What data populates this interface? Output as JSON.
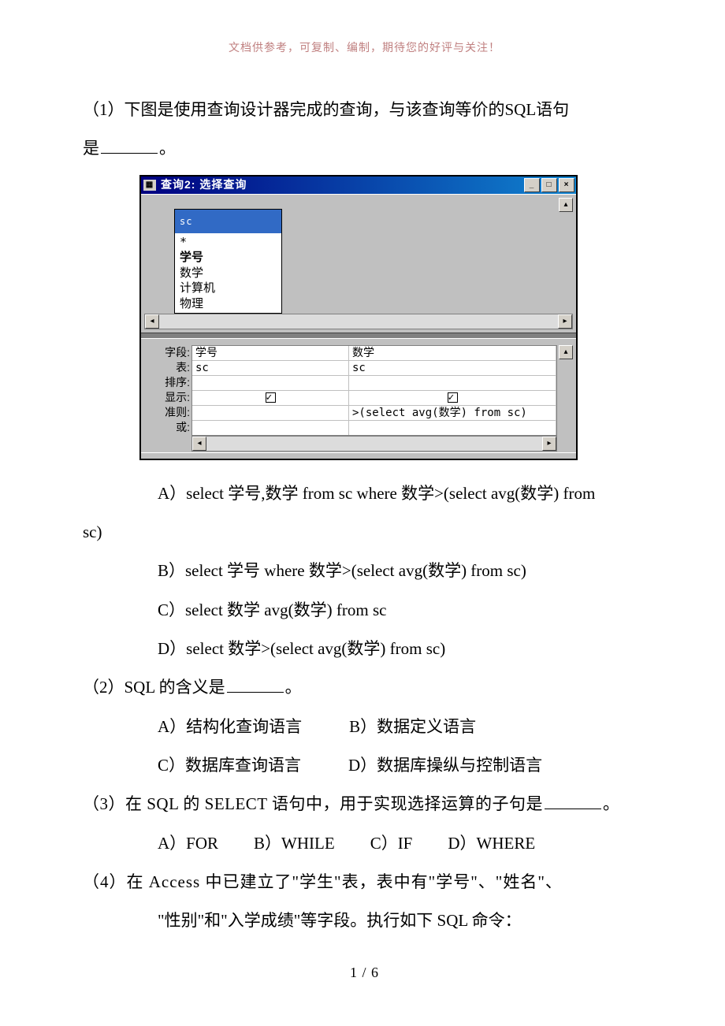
{
  "header_note": "文档供参考，可复制、编制，期待您的好评与关注！",
  "q1": {
    "text_a": "（1）下图是使用查询设计器完成的查询，与该查询等价的SQL语句",
    "text_b": "是",
    "period": "。",
    "optA": "A）select  学号,数学 from sc where  数学>(select avg(数学) from",
    "optA_cont": "sc)",
    "optB": "B）select  学号  where  数学>(select avg(数学) from sc)",
    "optC": "C）select  数学  avg(数学) from sc",
    "optD": "D）select  数学>(select avg(数学) from sc)"
  },
  "access": {
    "title": "查询2: 选择查询",
    "table_name": "sc",
    "fields": {
      "star": "*",
      "f1": "学号",
      "f2": "数学",
      "f3": "计算机",
      "f4": "物理"
    },
    "rowlabels": {
      "r1": "字段:",
      "r2": "表:",
      "r3": "排序:",
      "r4": "显示:",
      "r5": "准则:",
      "r6": "或:"
    },
    "grid": {
      "field1": "学号",
      "field2": "数学",
      "table1": "sc",
      "table2": "sc",
      "criteria2": ">(select avg(数学) from sc)"
    }
  },
  "q2": {
    "stem": "（2）SQL 的含义是",
    "period": "。",
    "A": "A）结构化查询语言",
    "B": "B）数据定义语言",
    "C": "C）数据库查询语言",
    "D": "D）数据库操纵与控制语言"
  },
  "q3": {
    "stem": "（3）在 SQL 的 SELECT 语句中，用于实现选择运算的子句是",
    "period": "。",
    "A": "A）FOR",
    "B": "B）WHILE",
    "C": "C）IF",
    "D": "D）WHERE"
  },
  "q4": {
    "line1": "（4）在 Access 中已建立了\"学生\"表，表中有\"学号\"、\"姓名\"、",
    "line2": "\"性别\"和\"入学成绩\"等字段。执行如下 SQL 命令："
  },
  "page_num": "1 / 6"
}
